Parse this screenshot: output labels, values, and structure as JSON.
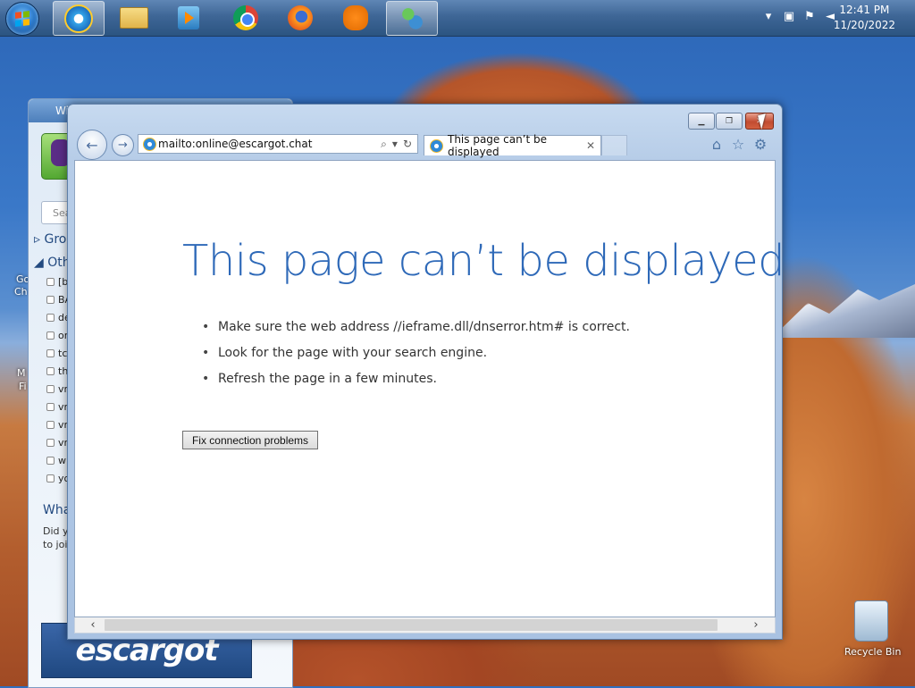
{
  "taskbar": {
    "apps": [
      {
        "name": "internet-explorer",
        "active": true
      },
      {
        "name": "file-explorer",
        "active": false
      },
      {
        "name": "media-player",
        "active": false
      },
      {
        "name": "chrome",
        "active": false
      },
      {
        "name": "firefox",
        "active": false
      },
      {
        "name": "avast",
        "active": false
      },
      {
        "name": "messenger",
        "active": true
      }
    ],
    "clock": {
      "time": "12:41 PM",
      "date": "11/20/2022"
    }
  },
  "messenger": {
    "title": "Wi",
    "search_placeholder": "Sea",
    "groups": [
      "Grou",
      "Othe"
    ],
    "contacts": [
      "[b",
      "BA",
      "de",
      "on",
      "tc",
      "th",
      "vr",
      "vr",
      "vr",
      "vr",
      "wi",
      "yo"
    ],
    "section_title": "Wha",
    "section_text_1": "Did y",
    "section_text_2": "to joi",
    "banner": "escargot"
  },
  "desktop": {
    "icons_left": [
      "Go",
      "Ch",
      "M",
      "Fi"
    ],
    "recycle_bin": "Recycle Bin"
  },
  "browser": {
    "address": "mailto:online@escargot.chat",
    "tab_title": "This page can’t be displayed",
    "error_title": "This page can’t be displayed",
    "tips": [
      "Make sure the web address //ieframe.dll/dnserror.htm# is correct.",
      "Look for the page with your search engine.",
      "Refresh the page in a few minutes."
    ],
    "fix_button": "Fix connection problems"
  },
  "colors": {
    "error_title": "#2e69b8",
    "taskbar": "#3e6696"
  }
}
